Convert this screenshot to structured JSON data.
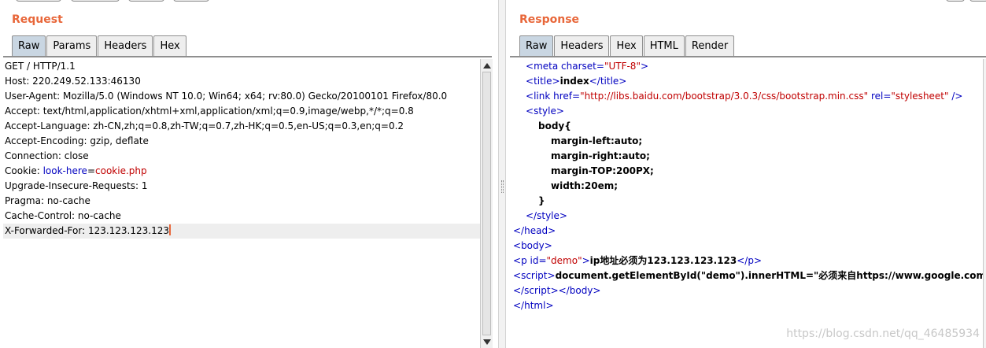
{
  "request": {
    "title": "Request",
    "tabs": [
      {
        "label": "Raw",
        "active": true
      },
      {
        "label": "Params",
        "active": false
      },
      {
        "label": "Headers",
        "active": false
      },
      {
        "label": "Hex",
        "active": false
      }
    ],
    "lines": [
      {
        "text": "GET / HTTP/1.1"
      },
      {
        "text": "Host: 220.249.52.133:46130"
      },
      {
        "text": "User-Agent: Mozilla/5.0 (Windows NT 10.0; Win64; x64; rv:80.0) Gecko/20100101 Firefox/80.0"
      },
      {
        "text": "Accept: text/html,application/xhtml+xml,application/xml;q=0.9,image/webp,*/*;q=0.8"
      },
      {
        "text": "Accept-Language: zh-CN,zh;q=0.8,zh-TW;q=0.7,zh-HK;q=0.5,en-US;q=0.3,en;q=0.2"
      },
      {
        "text": "Accept-Encoding: gzip, deflate"
      },
      {
        "text": "Connection: close"
      },
      {
        "cookie_label": "Cookie: ",
        "cookie_key": "look-here",
        "cookie_eq": "=",
        "cookie_val": "cookie.php"
      },
      {
        "text": "Upgrade-Insecure-Requests: 1"
      },
      {
        "text": "Pragma: no-cache"
      },
      {
        "text": "Cache-Control: no-cache"
      },
      {
        "text": "X-Forwarded-For: 123.123.123.123"
      }
    ]
  },
  "response": {
    "title": "Response",
    "tabs": [
      {
        "label": "Raw",
        "active": true
      },
      {
        "label": "Headers",
        "active": false
      },
      {
        "label": "Hex",
        "active": false
      },
      {
        "label": "HTML",
        "active": false
      },
      {
        "label": "Render",
        "active": false
      }
    ],
    "lines": {
      "l1": {
        "open": "<",
        "tag": "meta",
        "a1": "charset",
        "eq1": "=",
        "v1": "\"UTF-8\"",
        "close": ">"
      },
      "l2": {
        "open": "<",
        "tag": "title",
        "gt": ">",
        "text": "index",
        "end_open": "</",
        "end_tag": "title",
        "end_gt": ">"
      },
      "l3": {
        "open": "<",
        "tag": "link",
        "a1": "href",
        "eq1": "=",
        "v1": "\"http://libs.baidu.com/bootstrap/3.0.3/css/bootstrap.min.css\"",
        "a2": "rel",
        "eq2": "=",
        "v2": "\"stylesheet\"",
        "close": " />"
      },
      "l4": {
        "open": "<",
        "tag": "style",
        "gt": ">"
      },
      "l5": {
        "text": "body{"
      },
      "l6": {
        "text": "margin-left:auto;"
      },
      "l7": {
        "text": "margin-right:auto;"
      },
      "l8": {
        "text": "margin-TOP:200PX;"
      },
      "l9": {
        "text": "width:20em;"
      },
      "l10": {
        "text": "}"
      },
      "l11": {
        "open": "</",
        "tag": "style",
        "gt": ">"
      },
      "l12": {
        "open": "</",
        "tag": "head",
        "gt": ">"
      },
      "l13": {
        "open": "<",
        "tag": "body",
        "gt": ">"
      },
      "l14": {
        "open": "<",
        "tag": "p",
        "a1": "id",
        "eq1": "=",
        "v1": "\"demo\"",
        "gt": ">",
        "text": "ip地址必须为123.123.123.123",
        "end_open": "</",
        "end_tag": "p",
        "end_gt": ">"
      },
      "l15": {
        "open": "<",
        "tag": "script",
        "gt": ">",
        "text": "document.getElementById(\"demo\").innerHTML=\"必须来自https://www.google.com\";"
      },
      "l16": {
        "open": "</",
        "tag": "script",
        "gt": ">",
        "open2": "</",
        "tag2": "body",
        "gt2": ">"
      },
      "l17": {
        "open": "</",
        "tag": "html",
        "gt": ">"
      }
    }
  },
  "watermark": "https://blog.csdn.net/qq_46485934",
  "colors": {
    "title": "#e8673a",
    "tag": "#0000c0",
    "attr_value": "#c00000",
    "active_tab": "#c9d6e2"
  }
}
